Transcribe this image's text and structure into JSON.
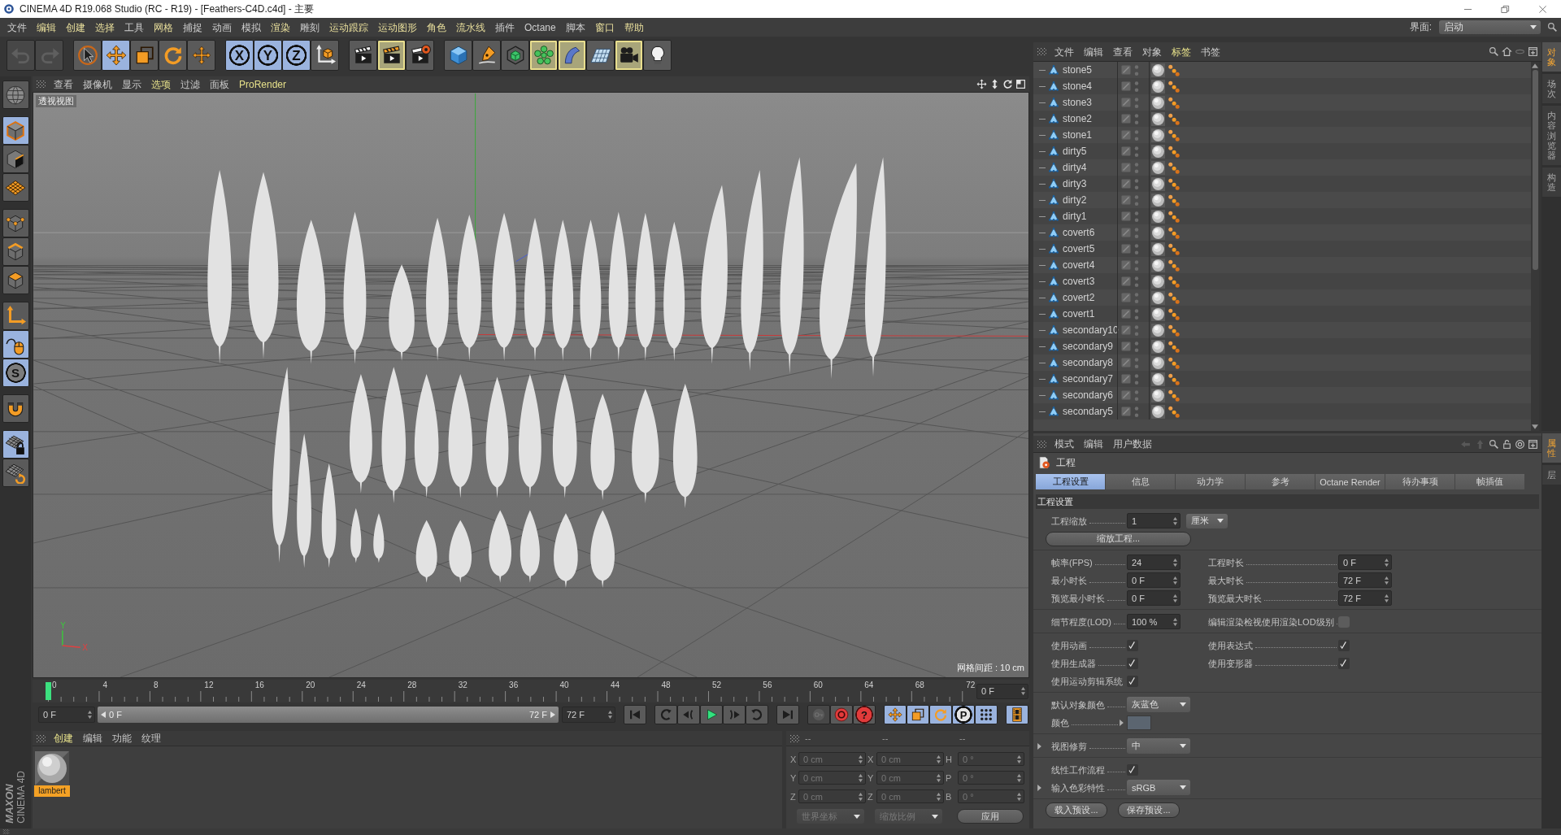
{
  "window": {
    "title": "CINEMA 4D R19.068 Studio (RC - R19) - [Feathers-C4D.c4d] - 主要"
  },
  "menu_bar": {
    "items": [
      {
        "label": "文件",
        "highlighted": false
      },
      {
        "label": "编辑",
        "highlighted": true
      },
      {
        "label": "创建",
        "highlighted": true
      },
      {
        "label": "选择",
        "highlighted": true
      },
      {
        "label": "工具",
        "highlighted": false
      },
      {
        "label": "网格",
        "highlighted": true
      },
      {
        "label": "捕捉",
        "highlighted": false
      },
      {
        "label": "动画",
        "highlighted": false
      },
      {
        "label": "模拟",
        "highlighted": false
      },
      {
        "label": "渲染",
        "highlighted": true
      },
      {
        "label": "雕刻",
        "highlighted": false
      },
      {
        "label": "运动跟踪",
        "highlighted": true
      },
      {
        "label": "运动图形",
        "highlighted": true
      },
      {
        "label": "角色",
        "highlighted": true
      },
      {
        "label": "流水线",
        "highlighted": true
      },
      {
        "label": "插件",
        "highlighted": false
      },
      {
        "label": "Octane",
        "highlighted": false
      },
      {
        "label": "脚本",
        "highlighted": false
      },
      {
        "label": "窗口",
        "highlighted": true
      },
      {
        "label": "帮助",
        "highlighted": true
      }
    ],
    "layout_label": "界面:",
    "layout_value": "启动"
  },
  "toolbar": {
    "groups": [
      [
        {
          "kind": "undo",
          "disabled": true,
          "highlighted": false
        },
        {
          "kind": "redo",
          "disabled": true,
          "highlighted": false
        }
      ],
      [
        {
          "kind": "select",
          "active": false,
          "disabled": false,
          "highlighted": false
        },
        {
          "kind": "move",
          "active": true,
          "disabled": false,
          "highlighted": false
        },
        {
          "kind": "scale",
          "active": false,
          "disabled": false,
          "highlighted": false
        },
        {
          "kind": "rotate",
          "active": false,
          "disabled": false,
          "highlighted": false
        },
        {
          "kind": "last_tool",
          "active": false,
          "disabled": false,
          "highlighted": false
        }
      ],
      [
        {
          "kind": "axis_lock",
          "label": "X",
          "active": true,
          "disabled": false,
          "highlighted": false
        },
        {
          "kind": "axis_lock",
          "label": "Y",
          "active": true,
          "disabled": false,
          "highlighted": false
        },
        {
          "kind": "axis_lock",
          "label": "Z",
          "active": true,
          "disabled": false,
          "highlighted": false
        },
        {
          "kind": "coordinate_system",
          "active": false,
          "disabled": false,
          "highlighted": false
        }
      ],
      [
        {
          "kind": "render_view",
          "active": false,
          "disabled": false,
          "highlighted": false
        },
        {
          "kind": "render_to_viewer",
          "active": false,
          "disabled": false,
          "highlighted": true
        },
        {
          "kind": "render_settings",
          "active": false,
          "disabled": false,
          "highlighted": false
        }
      ],
      [
        {
          "kind": "cube",
          "active": false,
          "disabled": false,
          "highlighted": false
        },
        {
          "kind": "pen",
          "active": false,
          "disabled": false,
          "highlighted": false
        },
        {
          "kind": "subdivision",
          "active": false,
          "disabled": false,
          "highlighted": false
        },
        {
          "kind": "cloner",
          "active": false,
          "disabled": false,
          "highlighted": true
        },
        {
          "kind": "deformer",
          "active": false,
          "disabled": false,
          "highlighted": true
        },
        {
          "kind": "floor",
          "active": false,
          "disabled": false,
          "highlighted": false
        },
        {
          "kind": "camera",
          "active": false,
          "disabled": false,
          "highlighted": true
        },
        {
          "kind": "light",
          "active": false,
          "disabled": false,
          "highlighted": false
        }
      ]
    ]
  },
  "tools": {
    "groups": [
      [
        {
          "kind": "make_editable",
          "active": false
        }
      ],
      [
        {
          "kind": "model",
          "active": true
        },
        {
          "kind": "texture",
          "active": false
        },
        {
          "kind": "workplane",
          "active": false
        }
      ],
      [
        {
          "kind": "points",
          "active": false
        },
        {
          "kind": "edges",
          "active": false
        },
        {
          "kind": "polygons",
          "active": false
        }
      ],
      [
        {
          "kind": "axis",
          "active": false
        },
        {
          "kind": "tweak",
          "active": true
        },
        {
          "kind": "snap",
          "label": "S",
          "active": true
        }
      ],
      [
        {
          "kind": "magnet",
          "active": false
        }
      ],
      [
        {
          "kind": "workplane_lock",
          "active": true
        },
        {
          "kind": "workplane_rotate",
          "active": false
        }
      ]
    ]
  },
  "branding": {
    "maker": "MAXON",
    "product": "CINEMA 4D"
  },
  "viewport": {
    "menu": [
      {
        "label": "查看",
        "highlighted": false
      },
      {
        "label": "摄像机",
        "highlighted": false
      },
      {
        "label": "显示",
        "highlighted": false
      },
      {
        "label": "选项",
        "highlighted": true
      },
      {
        "label": "过滤",
        "highlighted": false
      },
      {
        "label": "面板",
        "highlighted": false
      },
      {
        "label": "ProRender",
        "highlighted": true
      }
    ],
    "view_name": "透视视图",
    "grid_spacing": "网格间距 : 10 cm",
    "gizmo": {
      "y_label": "Y",
      "x_label": "X"
    }
  },
  "timeline": {
    "ticks": [
      "0",
      "4",
      "8",
      "12",
      "16",
      "20",
      "24",
      "28",
      "32",
      "36",
      "40",
      "44",
      "48",
      "52",
      "56",
      "60",
      "64",
      "68",
      "72"
    ],
    "level": 0,
    "frame": "0 F"
  },
  "transport": {
    "start_frame": "0 F",
    "range": {
      "start": "0 F",
      "end": "72 F"
    },
    "end_frame": "72 F",
    "groups": [
      [
        {
          "kind": "first_frame",
          "active": false,
          "disabled": false
        }
      ],
      [
        {
          "kind": "previous_key",
          "active": false,
          "disabled": false
        },
        {
          "kind": "previous_frame",
          "active": false,
          "disabled": false
        },
        {
          "kind": "play",
          "active": false,
          "disabled": false
        },
        {
          "kind": "next_frame",
          "active": false,
          "disabled": false
        },
        {
          "kind": "next_key",
          "active": false,
          "disabled": false
        }
      ],
      [
        {
          "kind": "last_frame",
          "active": false,
          "disabled": false
        }
      ],
      [
        {
          "kind": "record_key",
          "active": false,
          "disabled": true
        },
        {
          "kind": "record",
          "active": false,
          "disabled": false
        },
        {
          "kind": "autokey",
          "label": "?",
          "active": false,
          "disabled": false
        }
      ],
      [
        {
          "kind": "key_position",
          "active": true,
          "disabled": false
        },
        {
          "kind": "key_scale",
          "active": true,
          "disabled": false
        },
        {
          "kind": "key_rotation",
          "active": true,
          "disabled": false
        },
        {
          "kind": "key_parameter",
          "label": "P",
          "active": true,
          "disabled": false
        },
        {
          "kind": "key_points",
          "active": true,
          "disabled": false
        }
      ],
      [
        {
          "kind": "timeline_window",
          "active": true,
          "disabled": false
        }
      ]
    ]
  },
  "material_manager": {
    "menu": [
      {
        "label": "创建",
        "highlighted": true
      },
      {
        "label": "编辑",
        "highlighted": false
      },
      {
        "label": "功能",
        "highlighted": false
      },
      {
        "label": "纹理",
        "highlighted": false
      }
    ],
    "materials": [
      {
        "name": "lambert",
        "selected": true
      }
    ]
  },
  "coordinates": {
    "headers": [
      "--",
      "--",
      "--"
    ],
    "rows": [
      {
        "position_axis": "X",
        "position": "0 cm",
        "size_axis": "X",
        "size": "0 cm",
        "rotation_axis": "H",
        "rotation": "0 °"
      },
      {
        "position_axis": "Y",
        "position": "0 cm",
        "size_axis": "Y",
        "size": "0 cm",
        "rotation_axis": "P",
        "rotation": "0 °"
      },
      {
        "position_axis": "Z",
        "position": "0 cm",
        "size_axis": "Z",
        "size": "0 cm",
        "rotation_axis": "B",
        "rotation": "0 °"
      }
    ],
    "space": "世界坐标",
    "scale_mode": "缩放比例",
    "apply": "应用",
    "disabled": true
  },
  "object_manager": {
    "menu": [
      {
        "label": "文件",
        "highlighted": false
      },
      {
        "label": "编辑",
        "highlighted": false
      },
      {
        "label": "查看",
        "highlighted": false
      },
      {
        "label": "对象",
        "highlighted": false
      },
      {
        "label": "标签",
        "highlighted": true
      },
      {
        "label": "书签",
        "highlighted": false
      }
    ],
    "objects": [
      {
        "name": "stone5"
      },
      {
        "name": "stone4"
      },
      {
        "name": "stone3"
      },
      {
        "name": "stone2"
      },
      {
        "name": "stone1"
      },
      {
        "name": "dirty5"
      },
      {
        "name": "dirty4"
      },
      {
        "name": "dirty3"
      },
      {
        "name": "dirty2"
      },
      {
        "name": "dirty1"
      },
      {
        "name": "covert6"
      },
      {
        "name": "covert5"
      },
      {
        "name": "covert4"
      },
      {
        "name": "covert3"
      },
      {
        "name": "covert2"
      },
      {
        "name": "covert1"
      },
      {
        "name": "secondary10"
      },
      {
        "name": "secondary9"
      },
      {
        "name": "secondary8"
      },
      {
        "name": "secondary7"
      },
      {
        "name": "secondary6"
      },
      {
        "name": "secondary5"
      }
    ]
  },
  "object_side_tabs": [
    {
      "label": "对象",
      "selected": true
    },
    {
      "label": "场次",
      "selected": false
    },
    {
      "label": "内容浏览器",
      "selected": false
    },
    {
      "label": "构造",
      "selected": false
    }
  ],
  "attributes": {
    "menu": [
      {
        "label": "模式",
        "highlighted": false
      },
      {
        "label": "编辑",
        "highlighted": false
      },
      {
        "label": "用户数据",
        "highlighted": false
      }
    ],
    "title": "工程",
    "tabs": [
      {
        "label": "工程设置",
        "selected": true
      },
      {
        "label": "信息",
        "selected": false
      },
      {
        "label": "动力学",
        "selected": false
      },
      {
        "label": "参考",
        "selected": false
      },
      {
        "label": "Octane Render",
        "selected": false
      },
      {
        "label": "待办事项",
        "selected": false
      },
      {
        "label": "帧插值",
        "selected": false
      }
    ],
    "section": "工程设置",
    "groups": [
      {
        "rows": [
          {
            "left": {
              "kind": "number",
              "label": "工程缩放",
              "value": "1",
              "unit": "厘米"
            }
          },
          {
            "left": {
              "kind": "button",
              "label": "缩放工程..."
            }
          }
        ]
      },
      {
        "rows": [
          {
            "left": {
              "kind": "number",
              "label": "帧率(FPS)",
              "value": "24"
            },
            "right": {
              "kind": "number",
              "label": "工程时长",
              "value": "0 F"
            }
          },
          {
            "left": {
              "kind": "number",
              "label": "最小时长",
              "value": "0 F"
            },
            "right": {
              "kind": "number",
              "label": "最大时长",
              "value": "72 F"
            }
          },
          {
            "left": {
              "kind": "number",
              "label": "预览最小时长",
              "value": "0 F"
            },
            "right": {
              "kind": "number",
              "label": "预览最大时长",
              "value": "72 F"
            }
          }
        ]
      },
      {
        "rows": [
          {
            "left": {
              "kind": "number",
              "label": "细节程度(LOD)",
              "value": "100 %"
            },
            "right": {
              "kind": "checkbox",
              "label": "编辑渲染检视使用渲染LOD级别",
              "checked": false
            }
          }
        ]
      },
      {
        "rows": [
          {
            "left": {
              "kind": "checkbox",
              "label": "使用动画",
              "checked": true
            },
            "right": {
              "kind": "checkbox",
              "label": "使用表达式",
              "checked": true
            }
          },
          {
            "left": {
              "kind": "checkbox",
              "label": "使用生成器",
              "checked": true
            },
            "right": {
              "kind": "checkbox",
              "label": "使用变形器",
              "checked": true
            }
          },
          {
            "left": {
              "kind": "checkbox",
              "label": "使用运动剪辑系统",
              "checked": true
            }
          }
        ]
      },
      {
        "rows": [
          {
            "left": {
              "kind": "dropdown",
              "label": "默认对象颜色",
              "value": "灰蓝色"
            }
          },
          {
            "left": {
              "kind": "color",
              "label": "颜色",
              "color": "#5b6570",
              "expanded": false
            }
          }
        ]
      },
      {
        "rows": [
          {
            "left": {
              "kind": "dropdown",
              "label": "视图修剪",
              "value": "中",
              "expanded": false
            }
          }
        ]
      },
      {
        "rows": [
          {
            "left": {
              "kind": "checkbox",
              "label": "线性工作流程",
              "checked": true
            }
          },
          {
            "left": {
              "kind": "dropdown",
              "label": "输入色彩特性",
              "value": "sRGB",
              "expanded": false
            }
          }
        ]
      }
    ],
    "buttons": [
      {
        "label": "载入预设..."
      },
      {
        "label": "保存预设..."
      }
    ]
  },
  "attribute_side_tabs": [
    {
      "label": "属性",
      "selected": true
    },
    {
      "label": "层",
      "selected": false
    }
  ]
}
